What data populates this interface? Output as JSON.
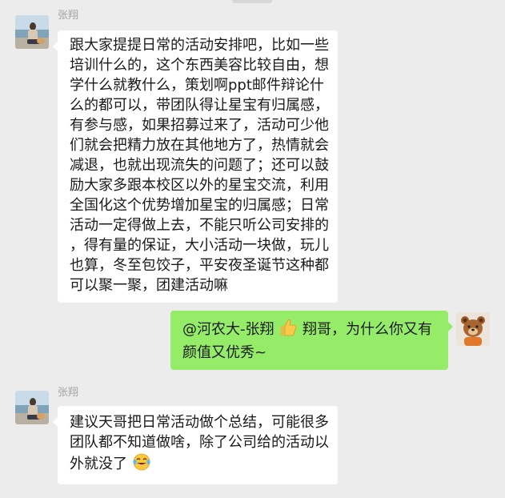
{
  "messages": [
    {
      "sender": "张翔",
      "direction": "incoming",
      "avatar_icon": "beach-photo-avatar",
      "lines": [
        "跟大家提提日常的活动安排吧，比如一些",
        "培训什么的，这个东西美容比较自由，想",
        "学什么就教什么，策划啊ppt邮件辩论什",
        "么的都可以，带团队得让星宝有归属感，",
        "有参与感，如果招募过来了，活动可少他",
        "们就会把精力放在其他地方了，热情就会",
        "减退，也就出现流失的问题了；还可以鼓",
        "励大家多跟本校区以外的星宝交流，利用",
        "全国化这个优势增加星宝的归属感；日常",
        "活动一定得做上去，不能只听公司安排的",
        "，得有量的保证，大小活动一块做，玩儿",
        "也算，冬至包饺子，平安夜圣诞节这种都",
        "可以聚一聚，团建活动嘛"
      ]
    },
    {
      "sender": "",
      "direction": "outgoing",
      "avatar_icon": "bear-avatar",
      "line1_before": "@河农大-张翔",
      "line1_emoji": "thumbs-up-icon",
      "line1_after": " 翔哥，为什么你又有",
      "line2": "颜值又优秀~"
    },
    {
      "sender": "张翔",
      "direction": "incoming",
      "avatar_icon": "beach-photo-avatar",
      "lines": [
        "建议天哥把日常活动做个总结，可能很多",
        "团队都不知道做啥，除了公司给的活动以"
      ],
      "last_line": "外就没了",
      "last_emoji": "tears-of-joy-icon"
    }
  ],
  "colors": {
    "background": "#ececec",
    "incoming_bubble": "#ffffff",
    "outgoing_bubble": "#95ec69",
    "sender_name": "#a3a3a3"
  }
}
